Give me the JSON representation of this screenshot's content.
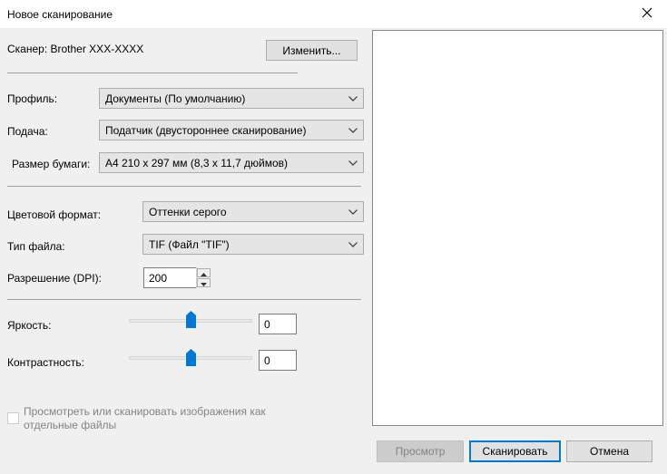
{
  "window": {
    "title": "Новое сканирование",
    "close_icon": "close-icon"
  },
  "scanner": {
    "label": "Сканер: Brother XXX-XXXX",
    "change_button": "Изменить..."
  },
  "profile": {
    "label": "Профиль:",
    "value": "Документы (По умолчанию)"
  },
  "feed": {
    "label": "Подача:",
    "value": "Податчик (двустороннее сканирование)"
  },
  "paper_size": {
    "label": "Размер бумаги:",
    "value": "A4 210 x 297 мм (8,3 x 11,7 дюймов)"
  },
  "color_format": {
    "label": "Цветовой формат:",
    "value": "Оттенки серого"
  },
  "file_type": {
    "label": "Тип файла:",
    "value": "TIF (Файл \"TIF\")"
  },
  "resolution": {
    "label": "Разрешение (DPI):",
    "value": "200"
  },
  "brightness": {
    "label": "Яркость:",
    "value": "0"
  },
  "contrast": {
    "label": "Контрастность:",
    "value": "0"
  },
  "separate_files": {
    "label_line1": "Просмотреть или сканировать изображения как",
    "label_line2": "отдельные файлы",
    "checked": false
  },
  "buttons": {
    "preview": "Просмотр",
    "scan": "Сканировать",
    "cancel": "Отмена"
  },
  "colors": {
    "accent": "#0078d7",
    "background": "#f0f0f0"
  }
}
